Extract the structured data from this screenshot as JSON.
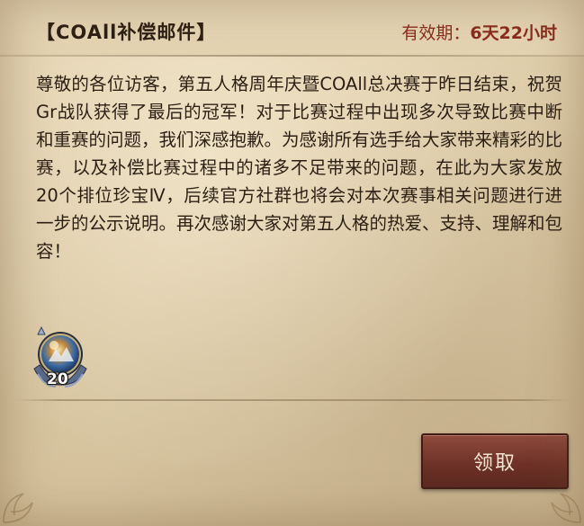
{
  "mail": {
    "title": "【COAll补偿邮件】",
    "expiry_label": "有效期：",
    "expiry_value": "6天22小时",
    "body": "尊敬的各位访客，第五人格周年庆暨COAll总决赛于昨日结束，祝贺Gr战队获得了最后的冠军！对于比赛过程中出现多次导致比赛中断和重赛的问题，我们深感抱歉。为感谢所有选手给大家带来精彩的比赛，以及补偿比赛过程中的诸多不足带来的问题，在此为大家发放20个排位珍宝Ⅳ，后续官方社群也将会对本次赛事相关问题进行进一步的公示说明。再次感谢大家对第五人格的热爱、支持、理解和包容！"
  },
  "reward": {
    "icon": "rank-treasure-icon",
    "count": "20"
  },
  "actions": {
    "claim_label": "领取"
  },
  "colors": {
    "parchment": "#dac8a4",
    "expiry_text": "#8b2a1c",
    "button": "#6f3228",
    "text": "#2b1f14"
  }
}
